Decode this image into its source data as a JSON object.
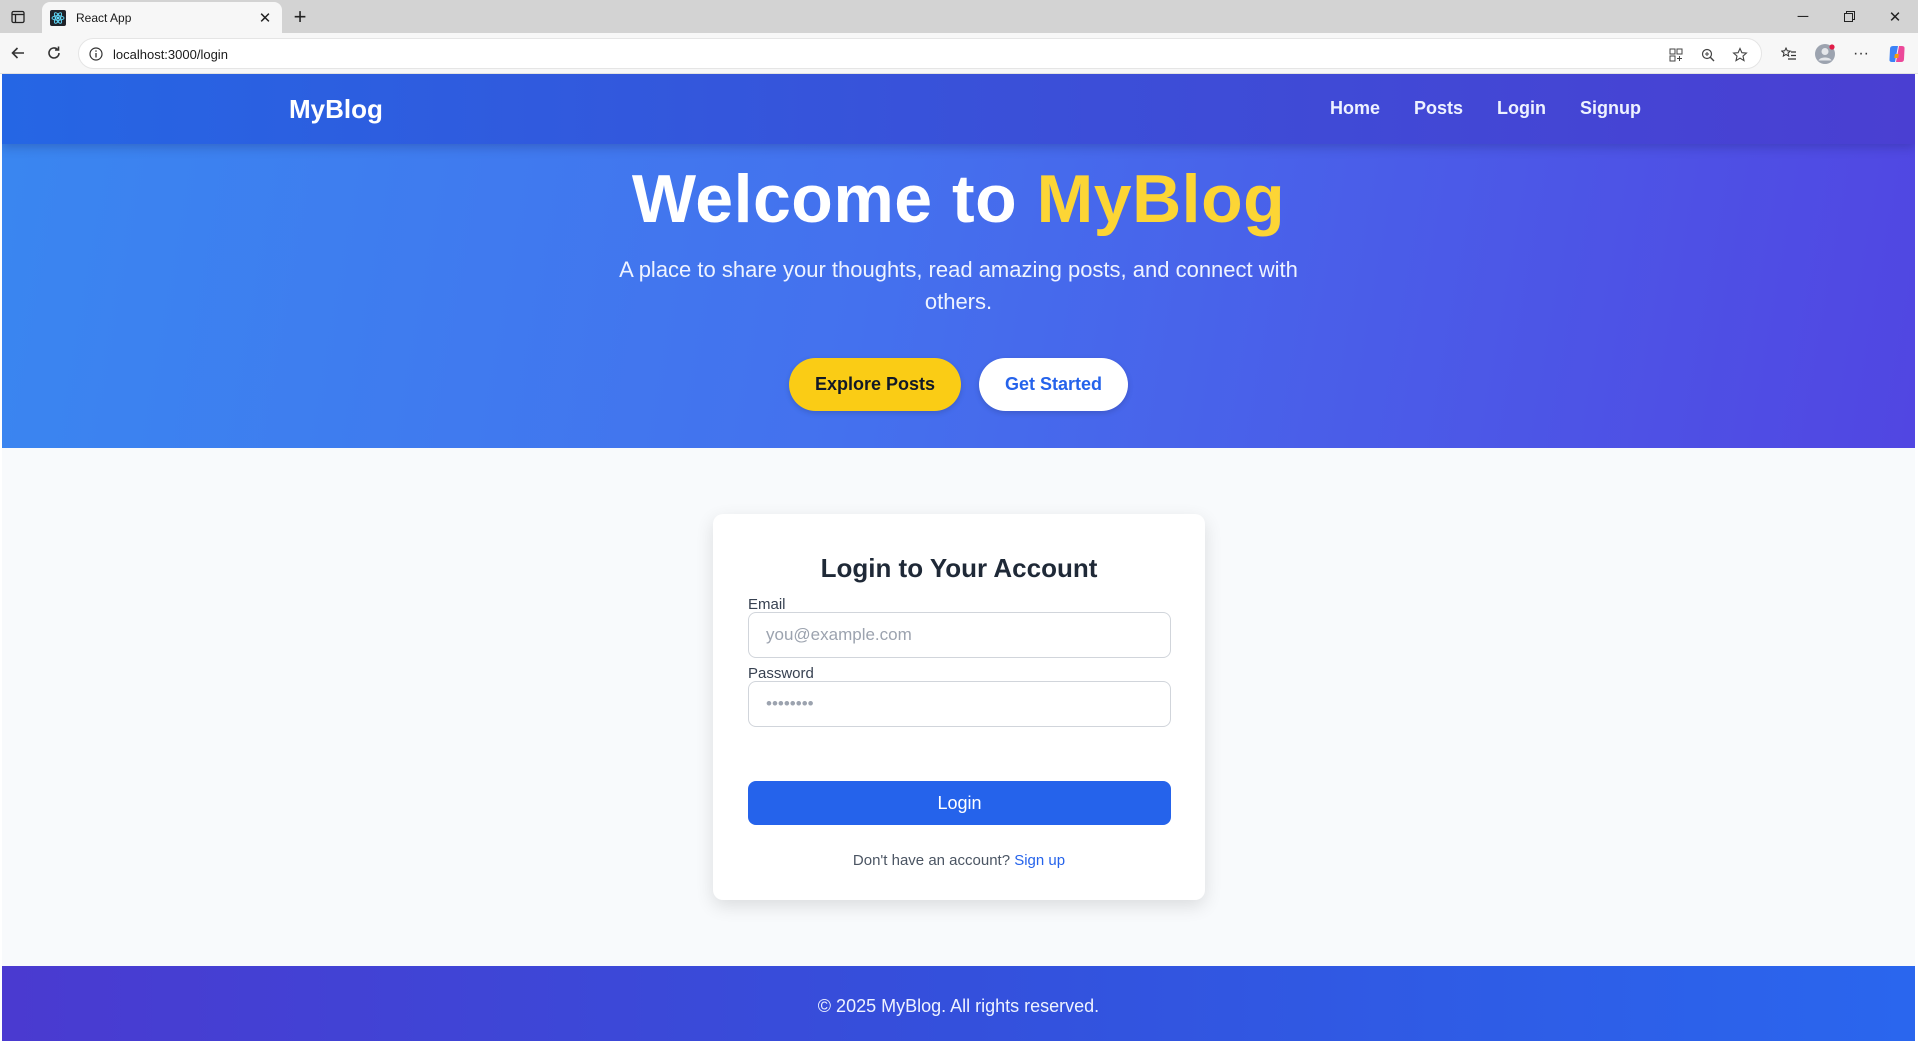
{
  "browser": {
    "tab_title": "React App",
    "url": "localhost:3000/login",
    "icons": {
      "tab_toggle": "tab-actions-icon",
      "favicon": "react-logo-icon",
      "tab_close": "close-icon",
      "new_tab": "plus-icon",
      "back": "back-arrow-icon",
      "reload": "reload-icon",
      "site_info": "info-icon"
    }
  },
  "nav": {
    "brand": "MyBlog",
    "links": [
      {
        "label": "Home"
      },
      {
        "label": "Posts"
      },
      {
        "label": "Login"
      },
      {
        "label": "Signup"
      }
    ]
  },
  "hero": {
    "title_prefix": "Welcome to ",
    "title_accent": "MyBlog",
    "subtitle": "A place to share your thoughts, read amazing posts, and connect with others.",
    "explore_label": "Explore Posts",
    "start_label": "Get Started"
  },
  "login": {
    "title": "Login to Your Account",
    "email_label": "Email",
    "email_placeholder": "you@example.com",
    "password_label": "Password",
    "password_placeholder": "••••••••",
    "button_label": "Login",
    "signup_prompt": "Don't have an account? ",
    "signup_link": "Sign up"
  },
  "footer": {
    "text": "© 2025 MyBlog. All rights reserved."
  },
  "colors": {
    "primary": "#2563eb",
    "accent_yellow": "#facc15",
    "hero_gradient_start": "#3a86f0",
    "hero_gradient_end": "#5146e2"
  }
}
